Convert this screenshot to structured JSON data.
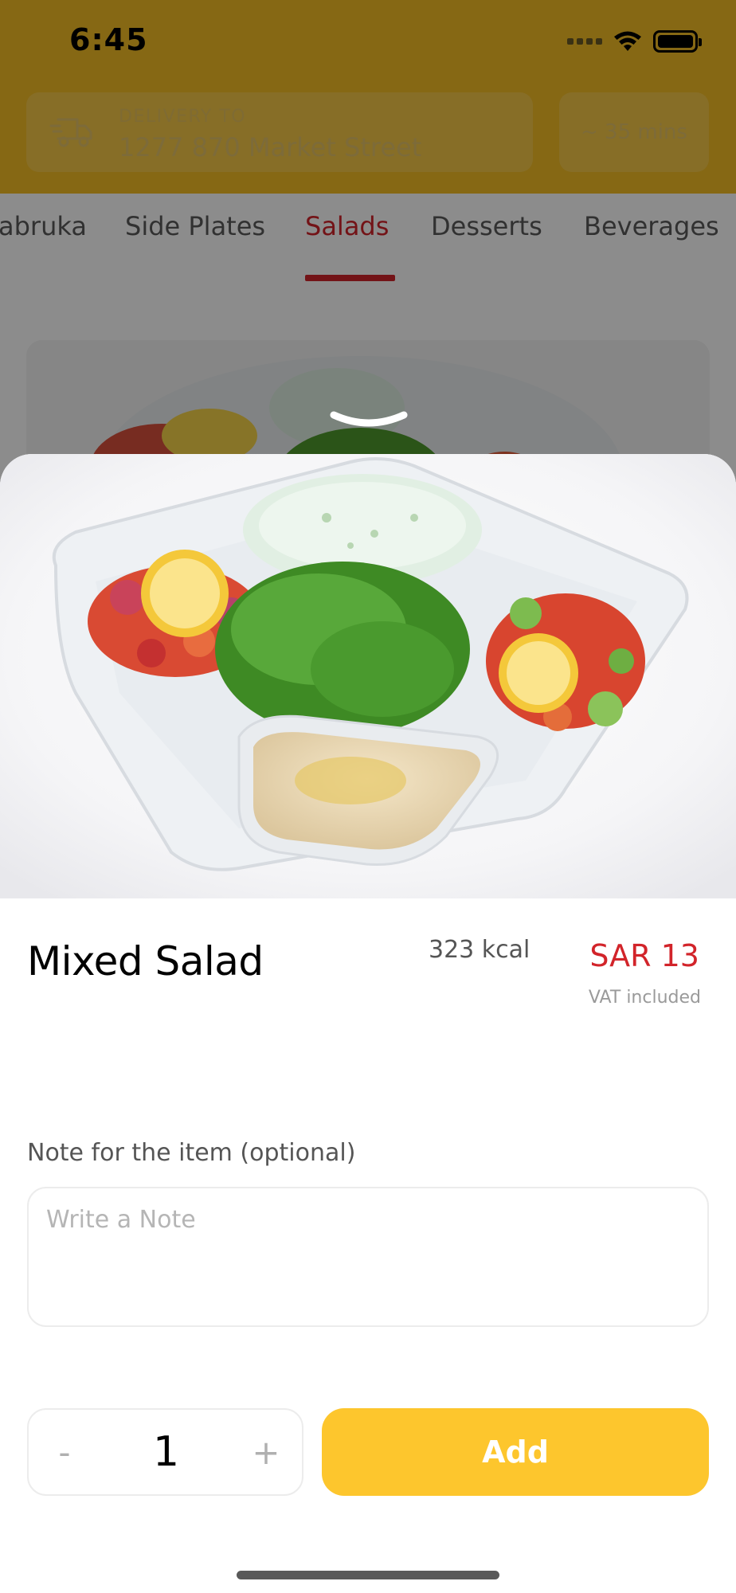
{
  "status_bar": {
    "time": "6:45"
  },
  "header": {
    "delivery_label": "DELIVERY TO",
    "delivery_address": "1277 870 Market Street",
    "eta": "~ 35 mins"
  },
  "tabs": [
    {
      "label": "abruka"
    },
    {
      "label": "Side Plates"
    },
    {
      "label": "Salads",
      "active": true
    },
    {
      "label": "Desserts"
    },
    {
      "label": "Beverages"
    }
  ],
  "item": {
    "name": "Mixed Salad",
    "calories": "323 kcal",
    "price": "SAR 13",
    "vat_note": "VAT included"
  },
  "note": {
    "label": "Note for the item (optional)",
    "placeholder": "Write a Note",
    "value": ""
  },
  "quantity": {
    "minus_label": "-",
    "value": "1",
    "plus_label": "+"
  },
  "add_button_label": "Add",
  "colors": {
    "brand_yellow": "#F5BE26",
    "accent_red": "#D2242A",
    "button_yellow": "#FDC62D"
  }
}
